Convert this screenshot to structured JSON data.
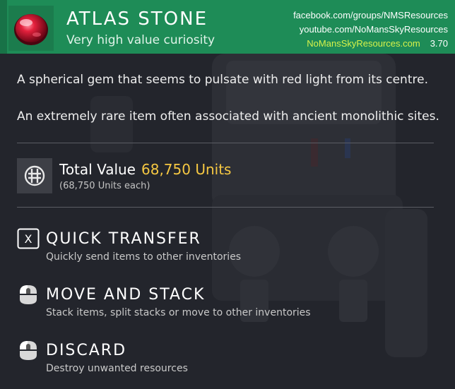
{
  "item": {
    "name": "ATLAS STONE",
    "category": "Very high value curiosity",
    "icon": "red-gem-icon",
    "descriptions": [
      "A spherical gem that seems to pulsate with red light from its centre.",
      "An extremely rare item often associated with ancient monolithic sites."
    ]
  },
  "source": {
    "facebook": "facebook.com/groups/NMSResources",
    "youtube": "youtube.com/NoMansSkyResources",
    "site": "NoMansSkyResources.com",
    "version": "3.70"
  },
  "value": {
    "label": "Total Value",
    "amount": "68,750 Units",
    "each": "(68,750 Units each)",
    "icon": "units-currency-icon"
  },
  "actions": [
    {
      "icon": "x-key-icon",
      "title": "QUICK TRANSFER",
      "desc": "Quickly send items to other inventories"
    },
    {
      "icon": "mouse-left-click-icon",
      "title": "MOVE AND STACK",
      "desc": "Stack items, split stacks or move to other inventories"
    },
    {
      "icon": "mouse-left-hold-icon",
      "title": "DISCARD",
      "desc": "Destroy unwanted resources"
    }
  ],
  "colors": {
    "header": "#1e8c57",
    "panel": "#23252c",
    "value_accent": "#f6c842",
    "site_accent": "#d6f24a"
  }
}
